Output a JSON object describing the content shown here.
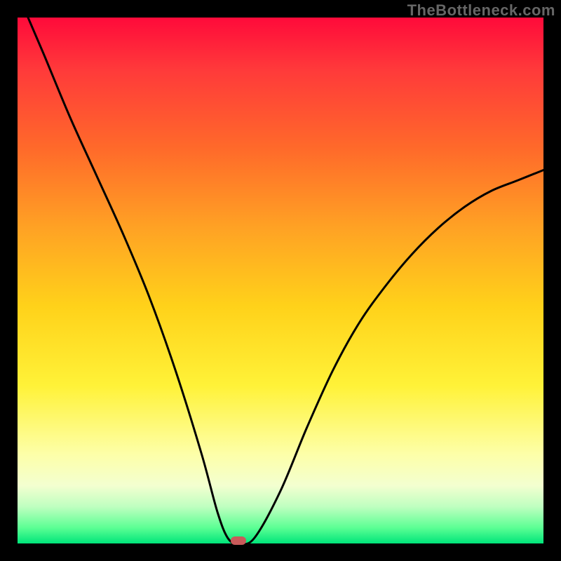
{
  "watermark": "TheBottleneck.com",
  "chart_data": {
    "type": "line",
    "title": "",
    "xlabel": "",
    "ylabel": "",
    "xlim": [
      0,
      100
    ],
    "ylim": [
      0,
      100
    ],
    "series": [
      {
        "name": "bottleneck-curve",
        "x": [
          2,
          5,
          10,
          15,
          20,
          25,
          30,
          35,
          38,
          40,
          42,
          45,
          50,
          55,
          60,
          65,
          70,
          75,
          80,
          85,
          90,
          95,
          100
        ],
        "y": [
          100,
          93,
          81,
          70,
          59,
          47,
          33,
          17,
          6,
          1,
          0,
          1,
          10,
          22,
          33,
          42,
          49,
          55,
          60,
          64,
          67,
          69,
          71
        ]
      }
    ],
    "marker": {
      "x": 42,
      "y": 0.5,
      "color": "#c85a5a"
    },
    "gradient_stops": [
      {
        "pos": 0,
        "color": "#ff0a3a"
      },
      {
        "pos": 10,
        "color": "#ff3a3a"
      },
      {
        "pos": 25,
        "color": "#ff6a2a"
      },
      {
        "pos": 40,
        "color": "#ffa224"
      },
      {
        "pos": 55,
        "color": "#ffd21a"
      },
      {
        "pos": 70,
        "color": "#fff238"
      },
      {
        "pos": 83,
        "color": "#fdffa8"
      },
      {
        "pos": 89,
        "color": "#f3ffd0"
      },
      {
        "pos": 93,
        "color": "#bfffc0"
      },
      {
        "pos": 97,
        "color": "#5cff94"
      },
      {
        "pos": 100,
        "color": "#00e57a"
      }
    ]
  }
}
